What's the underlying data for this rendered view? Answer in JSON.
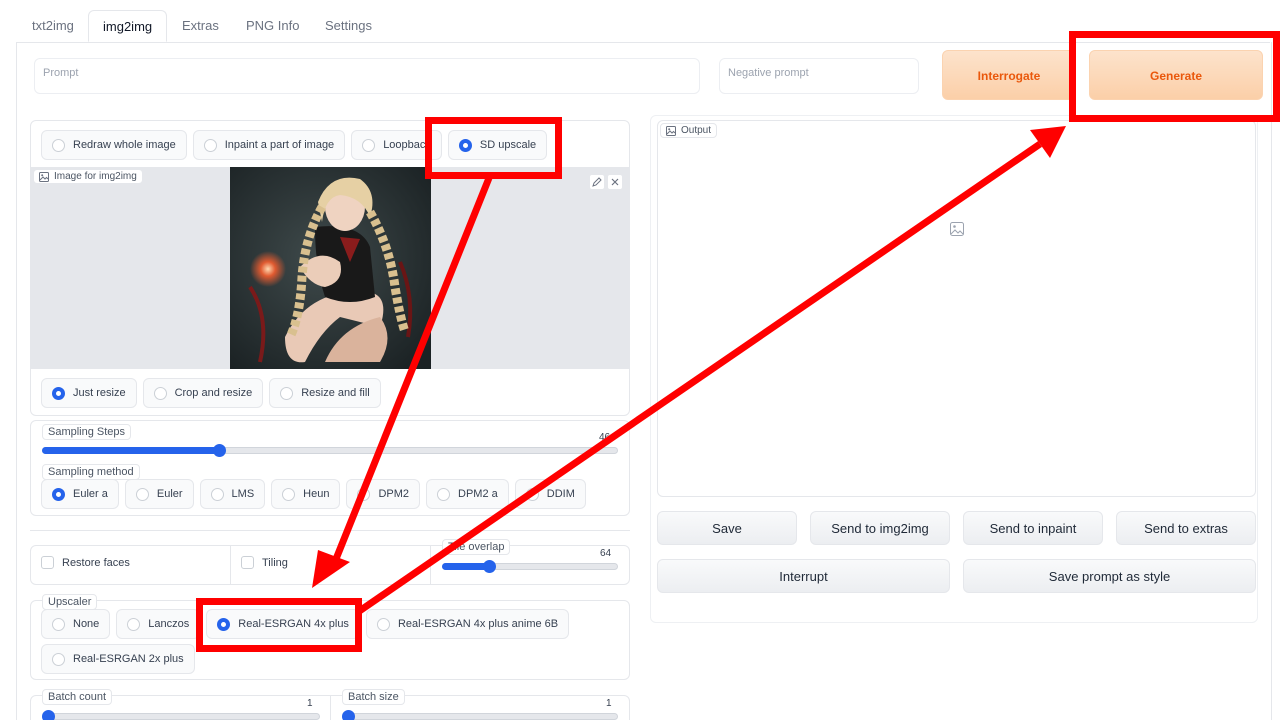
{
  "tabs": [
    "txt2img",
    "img2img",
    "Extras",
    "PNG Info",
    "Settings"
  ],
  "active_tab": "img2img",
  "prompt": {
    "placeholder": "Prompt",
    "negative_placeholder": "Negative prompt"
  },
  "buttons": {
    "interrogate": "Interrogate",
    "generate": "Generate"
  },
  "mode": {
    "options": [
      "Redraw whole image",
      "Inpaint a part of image",
      "Loopback",
      "SD upscale"
    ],
    "selected": "SD upscale"
  },
  "image_input": {
    "label": "Image for img2img"
  },
  "resize": {
    "options": [
      "Just resize",
      "Crop and resize",
      "Resize and fill"
    ],
    "selected": "Just resize"
  },
  "sampling_steps": {
    "label": "Sampling Steps",
    "value": "46",
    "fraction": 0.3
  },
  "sampling_method": {
    "label": "Sampling method",
    "options": [
      "Euler a",
      "Euler",
      "LMS",
      "Heun",
      "DPM2",
      "DPM2 a",
      "DDIM"
    ],
    "selected": "Euler a"
  },
  "restore_faces": {
    "label": "Restore faces",
    "checked": false
  },
  "tiling": {
    "label": "Tiling",
    "checked": false
  },
  "tile_overlap": {
    "label": "Tile overlap",
    "value": "64",
    "fraction": 0.25
  },
  "upscaler": {
    "label": "Upscaler",
    "options": [
      "None",
      "Lanczos",
      "Real-ESRGAN 4x plus",
      "Real-ESRGAN 4x plus anime 6B",
      "Real-ESRGAN 2x plus"
    ],
    "selected": "Real-ESRGAN 4x plus"
  },
  "batch_count": {
    "label": "Batch count",
    "value": "1",
    "fraction": 0.0
  },
  "batch_size": {
    "label": "Batch size",
    "value": "1",
    "fraction": 0.0
  },
  "output": {
    "label": "Output"
  },
  "output_buttons": [
    "Save",
    "Send to img2img",
    "Send to inpaint",
    "Send to extras"
  ],
  "action_buttons": [
    "Interrupt",
    "Save prompt as style"
  ],
  "colors": {
    "accent": "#2563eb",
    "annotation": "#ff0000",
    "generate_text": "#ea580c"
  },
  "icons": {
    "image": "image-icon",
    "edit": "pencil-icon",
    "close": "close-icon"
  }
}
